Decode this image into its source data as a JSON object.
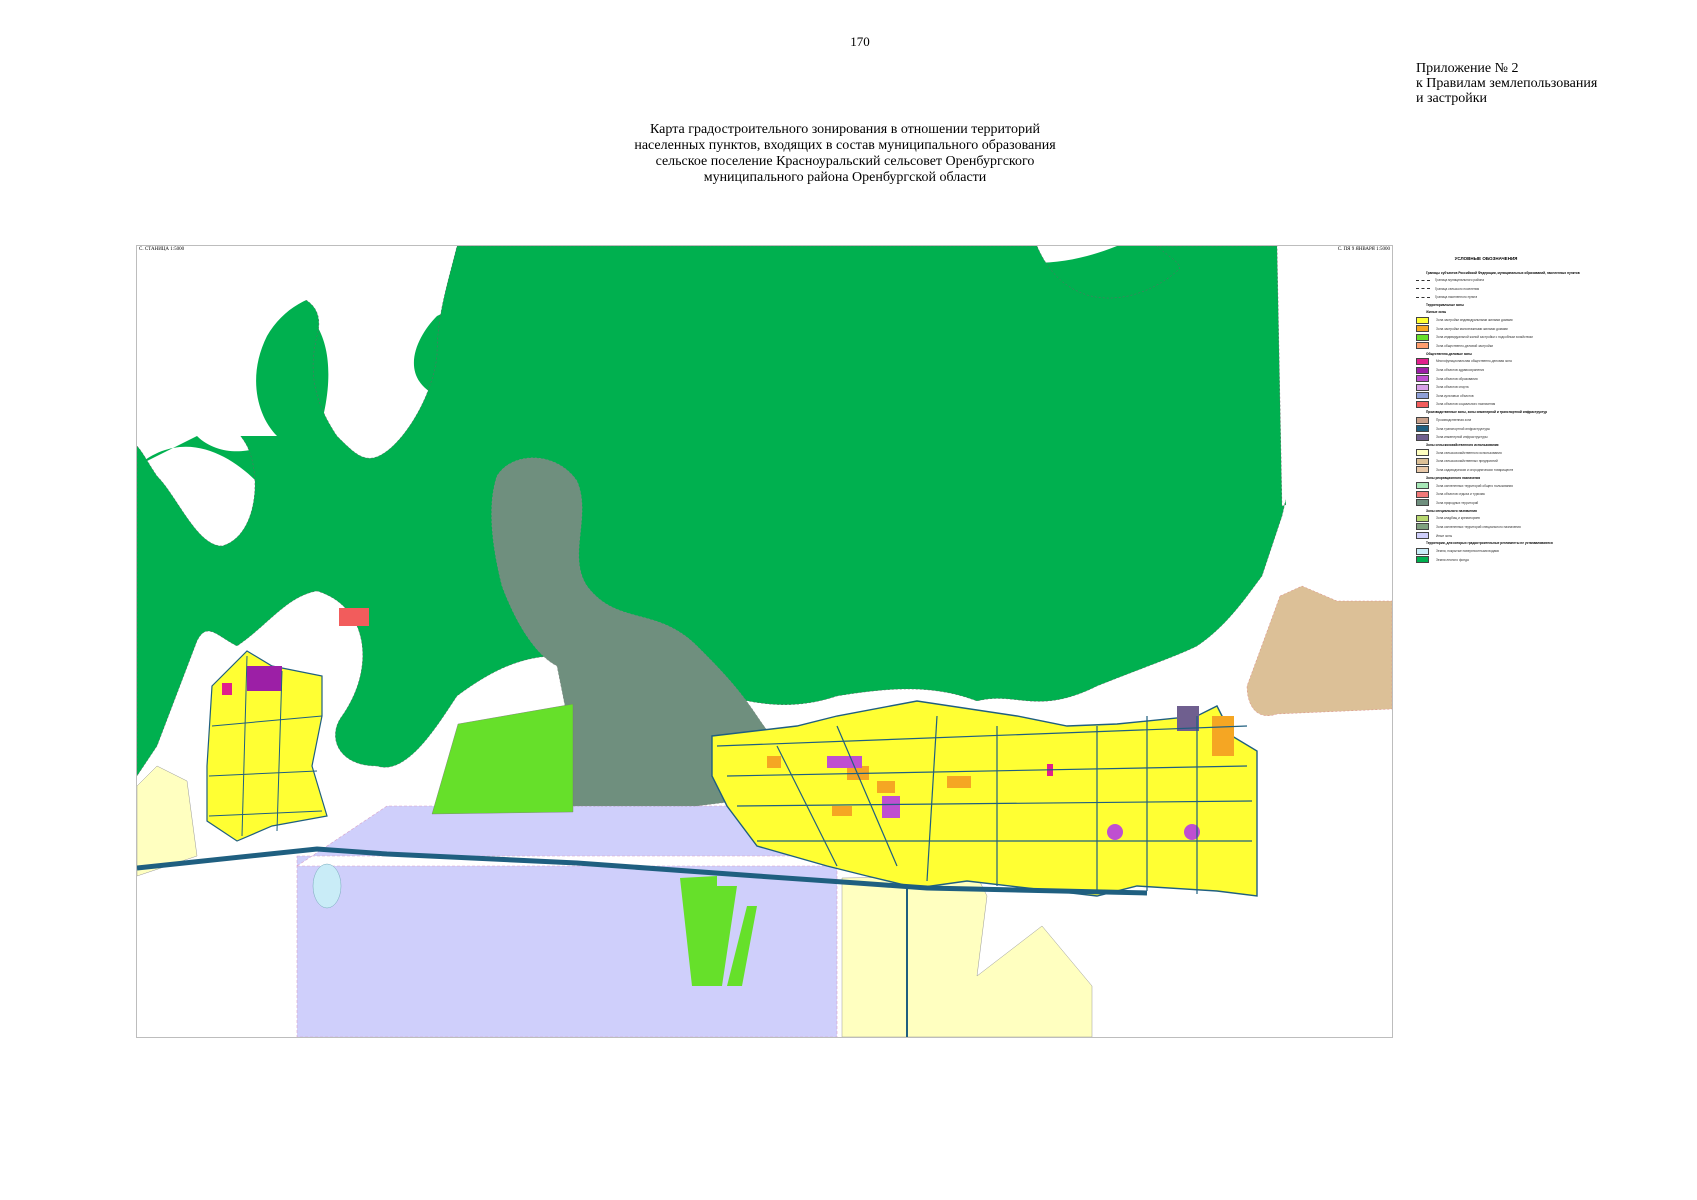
{
  "page_number": "170",
  "appendix": {
    "line1": "Приложение № 2",
    "line2": "к Правилам землепользования",
    "line3": "и застройки"
  },
  "title": {
    "line1": "Карта градостроительного зонирования в отношении территорий",
    "line2": "населенных пунктов, входящих в состав муниципального образования",
    "line3": "сельское поселение Красноуральский  сельсовет Оренбургского",
    "line4": "муниципального района Оренбургской области"
  },
  "map": {
    "corner_left": "С. СТАНИЦА 1:5000",
    "corner_right": "С. ПЯ 9 ЯНВАРЯ 1:5000",
    "zone_colors": {
      "forest": "#00b04f",
      "industrial_grey": "#6f8f7e",
      "agricultural_lavender": "#cfcffb",
      "agricultural_yellow": "#ffffc0",
      "residential_yellow": "#ffff33",
      "residential_orange": "#f5a623",
      "light_green": "#66e02a",
      "tan": "#dcc097",
      "public_purple": "#bf4fd0",
      "road_blue": "#1f5f80",
      "water": "#c9ecf7",
      "special_red": "#f25c5c"
    }
  },
  "legend": {
    "title": "УСЛОВНЫЕ ОБОЗНАЧЕНИЯ",
    "rows": [
      {
        "type": "header",
        "text": "Границы субъектов Российской Федерации, муниципальных образований, населенных пунктов"
      },
      {
        "type": "line",
        "text": "Граница муниципального района"
      },
      {
        "type": "line",
        "text": "Граница сельского поселения"
      },
      {
        "type": "line",
        "text": "Граница населенного пункта"
      },
      {
        "type": "header",
        "text": "Территориальные зоны"
      },
      {
        "type": "header",
        "text": "Жилые зоны"
      },
      {
        "type": "swatch",
        "color": "#ffff33",
        "text": "Зона застройки индивидуальными жилыми домами"
      },
      {
        "type": "swatch",
        "color": "#f5a623",
        "text": "Зона застройки малоэтажными жилыми домами"
      },
      {
        "type": "swatch",
        "color": "#66e02a",
        "text": "Зона индивидуальной жилой застройки с подсобным хозяйством"
      },
      {
        "type": "swatch",
        "color": "#ff9e6f",
        "text": "Зона общественно-деловой застройки"
      },
      {
        "type": "header",
        "text": "Общественно-деловые зоны"
      },
      {
        "type": "swatch",
        "color": "#e0208c",
        "text": "Многофункциональная общественно-деловая зона"
      },
      {
        "type": "swatch",
        "color": "#9c1fa6",
        "text": "Зона объектов здравоохранения"
      },
      {
        "type": "swatch",
        "color": "#bf4fd0",
        "text": "Зона объектов образования"
      },
      {
        "type": "swatch",
        "color": "#d8a0e8",
        "text": "Зона объектов спорта"
      },
      {
        "type": "swatch",
        "color": "#8fa0d8",
        "text": "Зона культовых объектов"
      },
      {
        "type": "swatch",
        "color": "#f25c5c",
        "text": "Зона объектов социального назначения"
      },
      {
        "type": "header",
        "text": "Производственные зоны, зоны инженерной и транспортной инфраструктур"
      },
      {
        "type": "swatch",
        "color": "#c8a08a",
        "text": "Производственная зона"
      },
      {
        "type": "swatch",
        "color": "#1f5f80",
        "text": "Зона транспортной инфраструктуры"
      },
      {
        "type": "swatch",
        "color": "#6f5f8f",
        "text": "Зона инженерной инфраструктуры"
      },
      {
        "type": "header",
        "text": "Зоны сельскохозяйственного использования"
      },
      {
        "type": "swatch",
        "color": "#ffffc0",
        "text": "Зона сельскохозяйственного использования"
      },
      {
        "type": "swatch",
        "color": "#dcc097",
        "text": "Зона сельскохозяйственных предприятий"
      },
      {
        "type": "swatch",
        "color": "#e8c8a8",
        "text": "Зона садоводческих и огороднических товариществ"
      },
      {
        "type": "header",
        "text": "Зоны рекреационного назначения"
      },
      {
        "type": "swatch",
        "color": "#a8e8b8",
        "text": "Зона озелененных территорий общего пользования"
      },
      {
        "type": "swatch",
        "color": "#f07878",
        "text": "Зона объектов отдыха и туризма"
      },
      {
        "type": "swatch",
        "color": "#6f8f7e",
        "text": "Зона природных территорий"
      },
      {
        "type": "header",
        "text": "Зоны специального назначения"
      },
      {
        "type": "swatch",
        "color": "#b8d870",
        "text": "Зона кладбищ и крематориев"
      },
      {
        "type": "swatch",
        "color": "#7fa07f",
        "text": "Зона озелененных территорий специального назначения"
      },
      {
        "type": "swatch",
        "color": "#cfcffb",
        "text": "Иные зоны"
      },
      {
        "type": "header",
        "text": "Территории, для которых градостроительные регламенты не устанавливаются"
      },
      {
        "type": "swatch",
        "color": "#c9ecf7",
        "text": "Земли, покрытые поверхностными водами"
      },
      {
        "type": "swatch",
        "color": "#00b04f",
        "text": "Земли лесного фонда"
      }
    ]
  }
}
